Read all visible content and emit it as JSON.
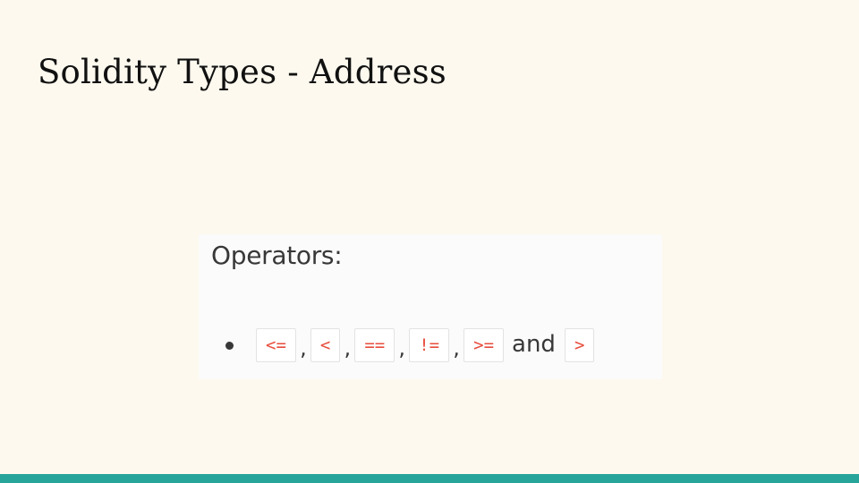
{
  "slide": {
    "title": "Solidity Types - Address"
  },
  "doc_excerpt": {
    "heading": "Operators:",
    "operators": [
      "<=",
      "<",
      "==",
      "!=",
      ">=",
      ">"
    ],
    "separator": ",",
    "conjunction": "and"
  },
  "colors": {
    "background": "#fdf9ee",
    "accent_bar": "#27a59a",
    "code_text": "#e74c3c"
  }
}
